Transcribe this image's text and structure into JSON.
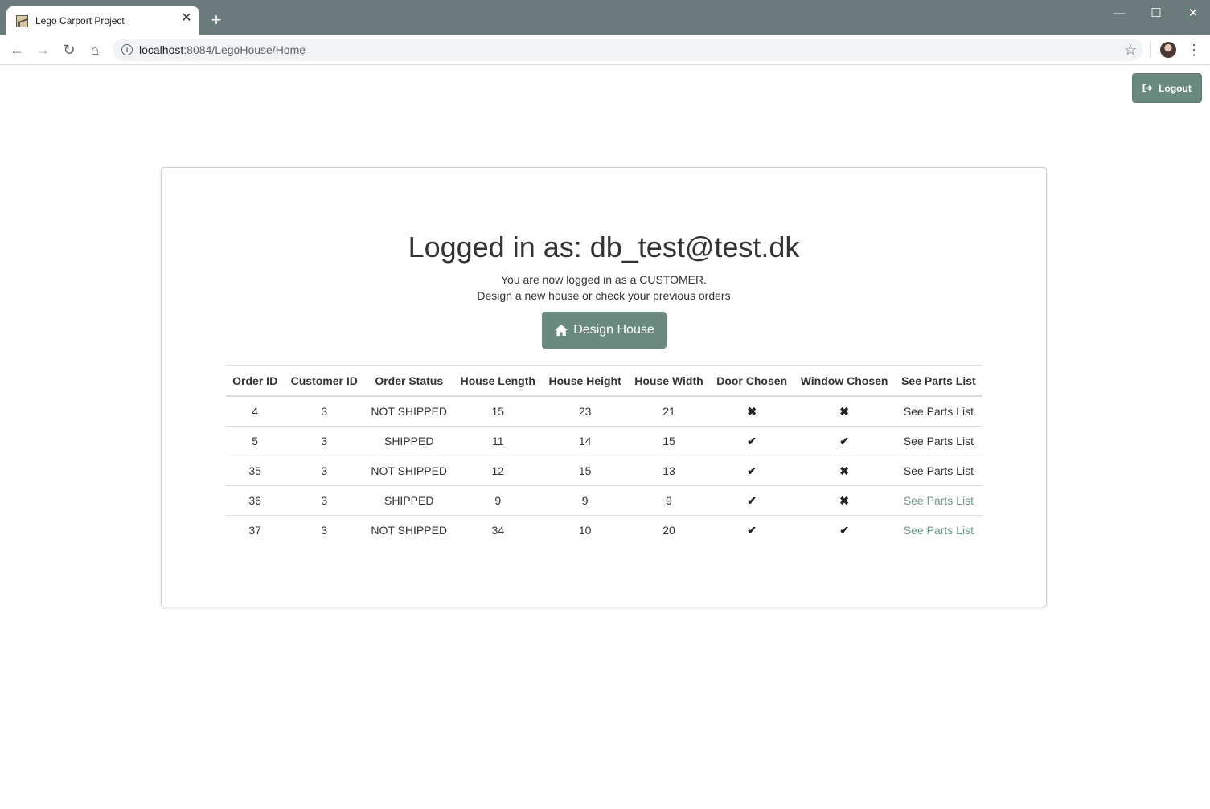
{
  "browser": {
    "tab_title": "Lego Carport Project",
    "url_host": "localhost",
    "url_rest": ":8084/LegoHouse/Home"
  },
  "page": {
    "logout_label": "Logout",
    "heading": "Logged in as: db_test@test.dk",
    "subtitle_line1": "You are now logged in as a CUSTOMER.",
    "subtitle_line2": "Design a new house or check your previous orders",
    "design_button_label": "Design House"
  },
  "orders": {
    "columns": [
      "Order ID",
      "Customer ID",
      "Order Status",
      "House Length",
      "House Height",
      "House Width",
      "Door Chosen",
      "Window Chosen",
      "See Parts List"
    ],
    "rows": [
      {
        "order_id": "4",
        "customer_id": "3",
        "status": "NOT SHIPPED",
        "length": "15",
        "height": "23",
        "width": "21",
        "door": false,
        "window": false,
        "link": "See Parts List",
        "visited": false
      },
      {
        "order_id": "5",
        "customer_id": "3",
        "status": "SHIPPED",
        "length": "11",
        "height": "14",
        "width": "15",
        "door": true,
        "window": true,
        "link": "See Parts List",
        "visited": false
      },
      {
        "order_id": "35",
        "customer_id": "3",
        "status": "NOT SHIPPED",
        "length": "12",
        "height": "15",
        "width": "13",
        "door": true,
        "window": false,
        "link": "See Parts List",
        "visited": false
      },
      {
        "order_id": "36",
        "customer_id": "3",
        "status": "SHIPPED",
        "length": "9",
        "height": "9",
        "width": "9",
        "door": true,
        "window": false,
        "link": "See Parts List",
        "visited": true
      },
      {
        "order_id": "37",
        "customer_id": "3",
        "status": "NOT SHIPPED",
        "length": "34",
        "height": "10",
        "width": "20",
        "door": true,
        "window": true,
        "link": "See Parts List",
        "visited": true
      }
    ]
  },
  "colors": {
    "titlebar": "#6b7a7b",
    "button": "#6a8a80",
    "visited_link": "#6a9a84"
  }
}
